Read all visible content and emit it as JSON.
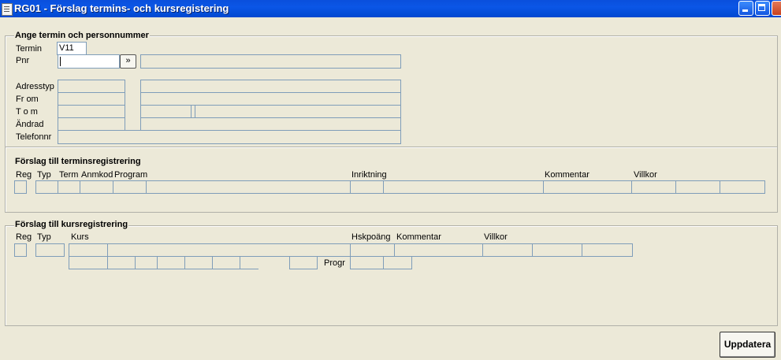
{
  "window": {
    "title": "RG01 - Förslag termins- och kursregistering"
  },
  "person": {
    "legend": "Ange termin och personnummer",
    "termin_label": "Termin",
    "termin_value": "V11",
    "pnr_label": "Pnr",
    "pnr_value": "",
    "lookup_button": "»",
    "adresstyp_label": "Adresstyp",
    "from_label": "Fr om",
    "tom_label": "T o m",
    "andrad_label": "Ändrad",
    "telefon_label": "Telefonnr"
  },
  "termin_reg": {
    "legend": "Förslag till terminsregistrering",
    "headers": {
      "reg": "Reg",
      "typ": "Typ",
      "term": "Term",
      "anmkod": "Anmkod",
      "program": "Program",
      "inriktning": "Inriktning",
      "kommentar": "Kommentar",
      "villkor": "Villkor"
    }
  },
  "kurs_reg": {
    "legend": "Förslag till kursregistrering",
    "headers": {
      "reg": "Reg",
      "typ": "Typ",
      "kurs": "Kurs",
      "hskpoang": "Hskpoäng",
      "kommentar": "Kommentar",
      "villkor": "Villkor"
    },
    "progr_label": "Progr"
  },
  "actions": {
    "update_label": "Uppdatera"
  }
}
